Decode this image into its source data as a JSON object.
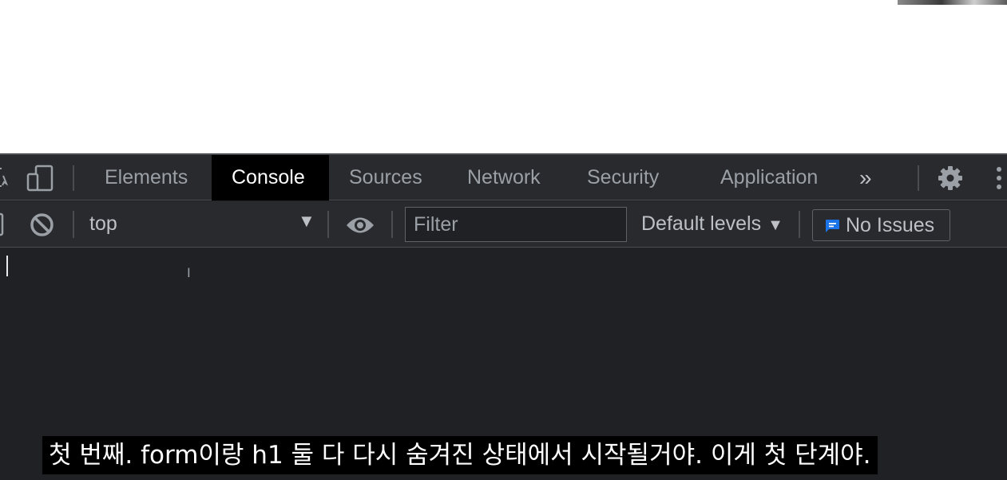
{
  "devtools": {
    "tabs": [
      {
        "label": "Elements",
        "active": false
      },
      {
        "label": "Console",
        "active": true
      },
      {
        "label": "Sources",
        "active": false
      },
      {
        "label": "Network",
        "active": false
      },
      {
        "label": "Security",
        "active": false
      },
      {
        "label": "Application",
        "active": false
      }
    ],
    "more_tabs_label": "»",
    "toolbar": {
      "context_value": "top",
      "filter_placeholder": "Filter",
      "filter_value": "",
      "levels_label": "Default levels",
      "issues_label": "No Issues"
    },
    "icons": {
      "inspect": "inspect-element-icon",
      "device": "device-toolbar-icon",
      "settings": "gear-icon",
      "menu": "kebab-menu-icon",
      "sidebar": "sidebar-toggle-icon",
      "clear": "clear-console-icon",
      "live_expression": "eye-icon",
      "issues": "message-icon"
    },
    "colors": {
      "panel_bg": "#202124",
      "toolbar_bg": "#292a2d",
      "active_tab_bg": "#000000",
      "issues_icon": "#1a73e8"
    }
  },
  "subtitle": {
    "text": "첫 번째. form이랑 h1 둘 다 다시 숨겨진 상태에서 시작될거야. 이게 첫 단계야."
  }
}
